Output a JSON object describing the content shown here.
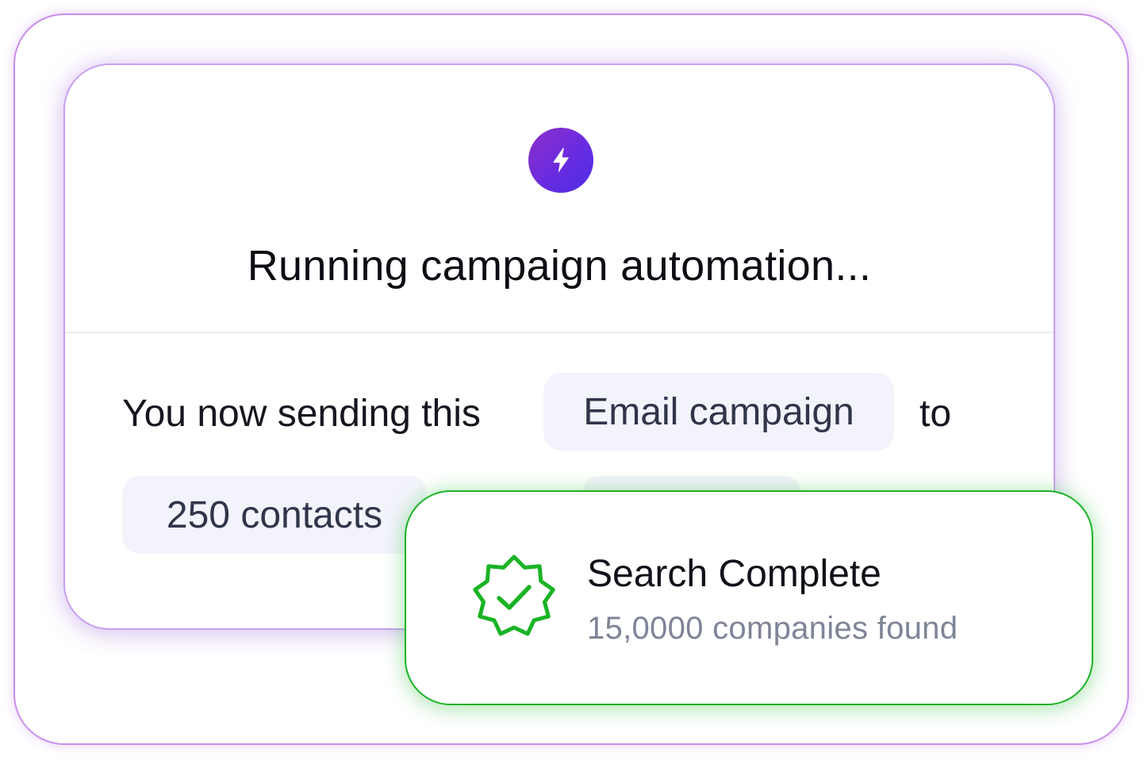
{
  "campaign": {
    "icon": "bolt-icon",
    "title": "Running campaign automation...",
    "sentence_prefix": "You now sending this",
    "channel_chip": "Email campaign",
    "sentence_to": "to",
    "audience_chip": "250 contacts"
  },
  "notice": {
    "icon": "verified-check-icon",
    "title": "Search Complete",
    "subtitle": "15,0000 companies found"
  },
  "colors": {
    "accent_purple": "#6a2be0",
    "frame_purple": "#c98fea",
    "success_green": "#1ab325",
    "chip_background": "#f3f3fc"
  }
}
